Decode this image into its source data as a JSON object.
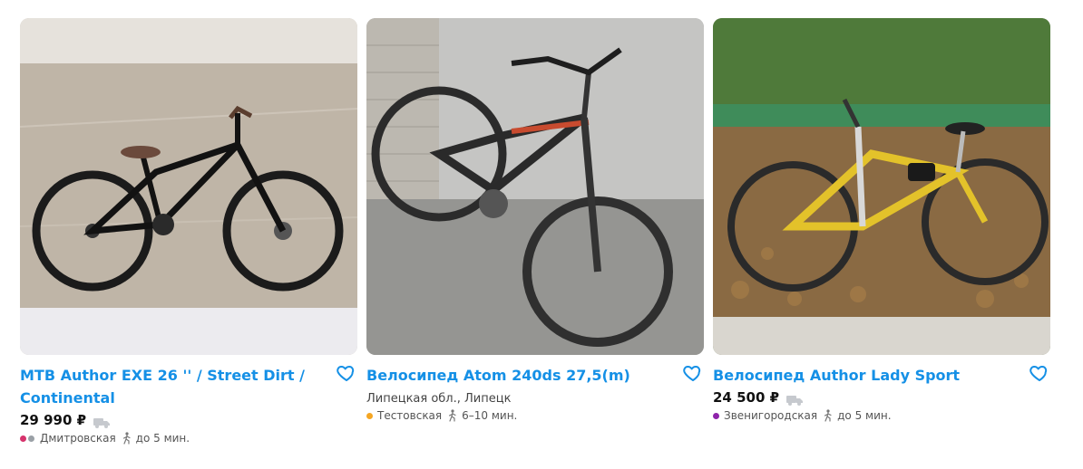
{
  "listings": [
    {
      "title": "MTB Author EXE 26 '' / Street Dirt / Continental",
      "price": "29 990 ₽",
      "region": "",
      "metro": {
        "name": "Дмитровская",
        "time": "до 5 мин.",
        "colors": [
          "#d6336c",
          "#9aa0a6"
        ]
      }
    },
    {
      "title": "Велосипед Atom 240ds 27,5(m)",
      "price": "",
      "region": "Липецкая обл., Липецк",
      "metro": {
        "name": "Тестовская",
        "time": "6–10 мин.",
        "colors": [
          "#f5a623"
        ]
      }
    },
    {
      "title": "Велосипед Author Lady Sport",
      "price": "24 500 ₽",
      "region": "",
      "metro": {
        "name": "Звенигородская",
        "time": "до 5 мин.",
        "colors": [
          "#8e24aa"
        ]
      }
    }
  ],
  "icons": {
    "favorite": "heart-outline-icon",
    "delivery": "truck-icon",
    "walk": "walking-person-icon"
  },
  "colors": {
    "title_link": "#1590e6",
    "price": "#111111",
    "meta_text": "#555555"
  }
}
